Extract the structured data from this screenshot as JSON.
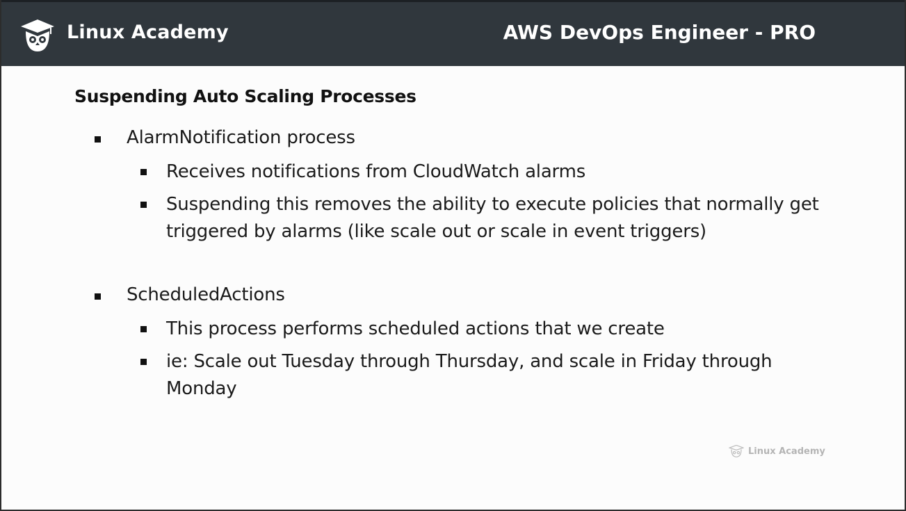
{
  "header": {
    "brand": "Linux Academy",
    "course_title": "AWS DevOps Engineer - PRO"
  },
  "slide": {
    "title": "Suspending Auto Scaling Processes",
    "sections": [
      {
        "label": "AlarmNotification process",
        "items": [
          "Receives notifications from CloudWatch alarms",
          "Suspending this removes the ability to execute policies that normally get triggered by alarms (like scale out or scale in event triggers)"
        ]
      },
      {
        "label": "ScheduledActions",
        "items": [
          "This process performs scheduled actions that we create",
          "ie: Scale out Tuesday through Thursday, and scale in Friday through Monday"
        ]
      }
    ]
  },
  "watermark": {
    "text": "Linux Academy"
  },
  "icons": {
    "logo": "owl-graduation-cap-icon"
  },
  "colors": {
    "header_bg": "#30373d",
    "text": "#1a1a1a"
  }
}
